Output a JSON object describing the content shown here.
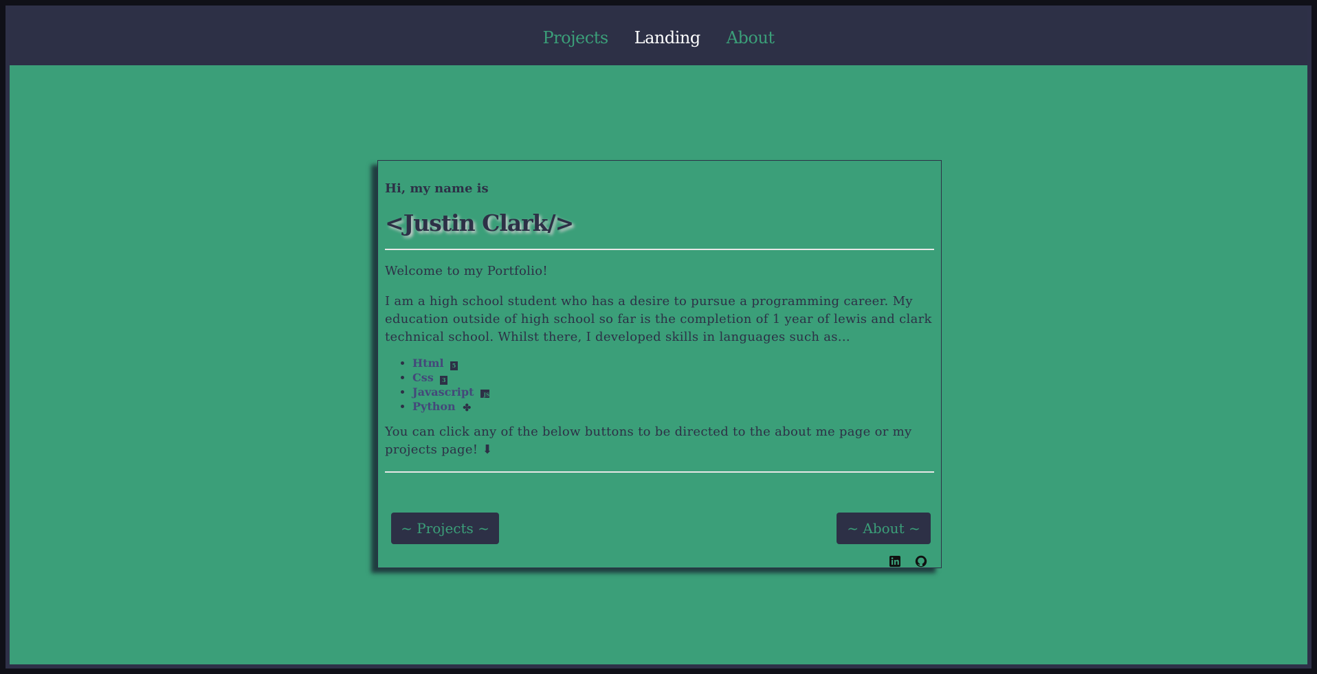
{
  "nav": {
    "items": [
      {
        "label": "Projects",
        "active": false
      },
      {
        "label": "Landing",
        "active": true
      },
      {
        "label": "About",
        "active": false
      }
    ]
  },
  "card": {
    "greeting": "Hi, my name is",
    "name": "<Justin Clark/>",
    "welcome": "Welcome to my Portfolio!",
    "intro": "I am a high school student who has a desire to pursue a programming career. My education outside of high school so far is the completion of 1 year of lewis and clark technical school. Whilst there, I developed skills in languages such as...",
    "skills": [
      {
        "label": "Html",
        "icon": "html5-icon"
      },
      {
        "label": "Css",
        "icon": "css3-icon"
      },
      {
        "label": "Javascript",
        "icon": "js-icon"
      },
      {
        "label": "Python",
        "icon": "python-icon"
      }
    ],
    "cta": "You can click any of the below buttons to be directed to the about me page or my projects page! ⬇",
    "projects_button": "~ Projects ~",
    "about_button": "~ About ~",
    "social_icons": [
      "linkedin-icon",
      "github-icon"
    ]
  },
  "colors": {
    "background": "#3b9f79",
    "navbar": "#2d3046",
    "text": "#2d3046",
    "active_nav": "#ffffff"
  }
}
